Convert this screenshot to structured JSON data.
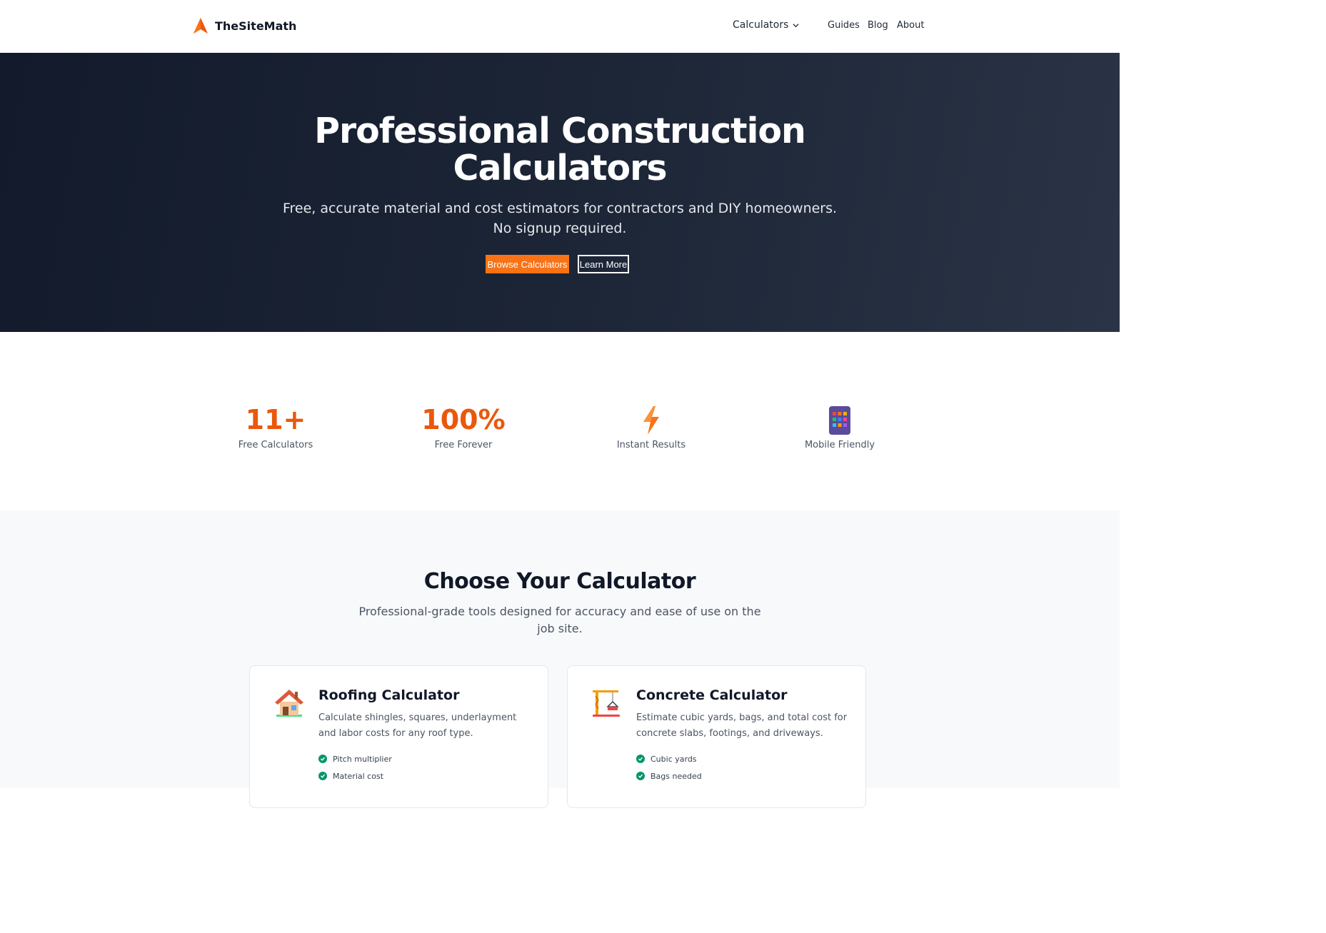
{
  "header": {
    "logo_text": "TheSiteMath",
    "nav": {
      "calculators": "Calculators",
      "guides": "Guides",
      "blog": "Blog",
      "about": "About"
    }
  },
  "hero": {
    "title_line1": "Professional Construction",
    "title_line2": "Calculators",
    "subtitle": "Free, accurate material and cost estimators for contractors and DIY homeowners. No signup required.",
    "primary_button": "Browse Calculators",
    "secondary_button": "Learn More"
  },
  "stats": [
    {
      "value": "11+",
      "label": "Free Calculators"
    },
    {
      "value": "100%",
      "label": "Free Forever"
    },
    {
      "icon": "lightning-icon",
      "label": "Instant Results"
    },
    {
      "icon": "mobile-phone-icon",
      "label": "Mobile Friendly"
    }
  ],
  "calculators_section": {
    "title": "Choose Your Calculator",
    "subtitle": "Professional-grade tools designed for accuracy and ease of use on the job site.",
    "cards": [
      {
        "icon": "house-icon",
        "title": "Roofing Calculator",
        "description": "Calculate shingles, squares, underlayment and labor costs for any roof type.",
        "features": [
          "Pitch multiplier",
          "Material cost"
        ]
      },
      {
        "icon": "crane-icon",
        "title": "Concrete Calculator",
        "description": "Estimate cubic yards, bags, and total cost for concrete slabs, footings, and driveways.",
        "features": [
          "Cubic yards",
          "Bags needed"
        ]
      }
    ]
  },
  "colors": {
    "accent": "#f97316",
    "stat_orange": "#ea580c",
    "hero_bg": "#1c2536",
    "check_green": "#059669"
  }
}
